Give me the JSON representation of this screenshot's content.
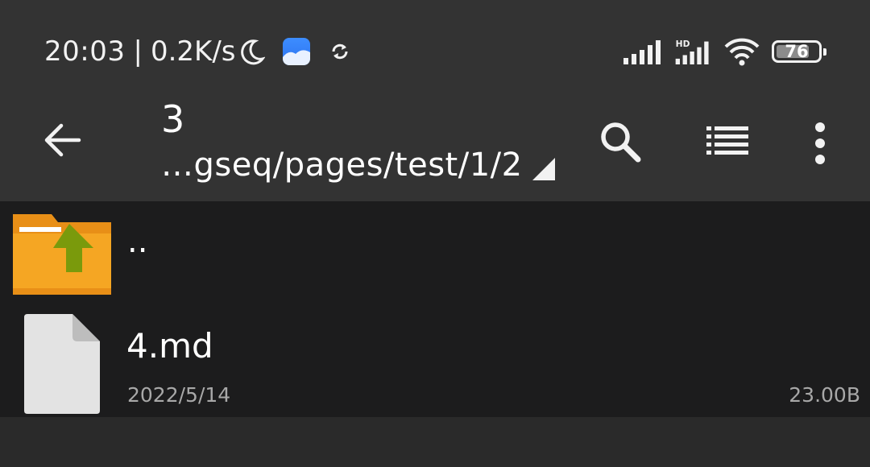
{
  "status_bar": {
    "time": "20:03",
    "separator": "|",
    "network_speed": "0.2K/s",
    "battery_level": "76",
    "battery_fraction": 0.76,
    "icons": [
      "moon-icon",
      "app-notification-icon",
      "sync-icon",
      "signal-icon",
      "hd-signal-icon",
      "wifi-icon",
      "battery-icon"
    ]
  },
  "toolbar": {
    "title": "3",
    "path": "…gseq/pages/test/1/2",
    "icons": [
      "back-arrow-icon",
      "path-dropdown-icon",
      "search-icon",
      "list-view-icon",
      "more-vert-icon"
    ]
  },
  "file_list": {
    "parent_entry": {
      "label": "..",
      "icon": "folder-up-icon"
    },
    "files": [
      {
        "name": "4.md",
        "date": "2022/5/14",
        "size": "23.00B",
        "icon": "file-icon"
      }
    ]
  },
  "colors": {
    "bar_background": "#333333",
    "list_background": "#1c1c1d",
    "screen_background": "#2a2a2a",
    "folder_orange": "#f5a623",
    "arrow_green": "#7a9a0c",
    "secondary_text": "#a8a8a8"
  }
}
